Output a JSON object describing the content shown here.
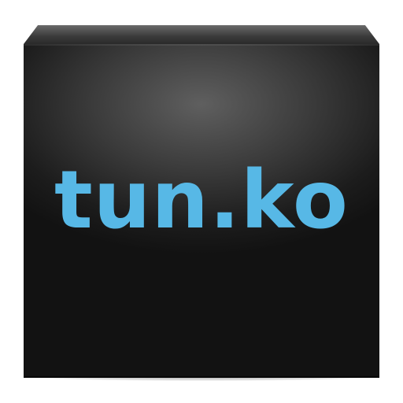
{
  "icon": {
    "text": "tun.ko",
    "text_color": "#57b8e6",
    "tile_color": "#1a1a1a"
  }
}
